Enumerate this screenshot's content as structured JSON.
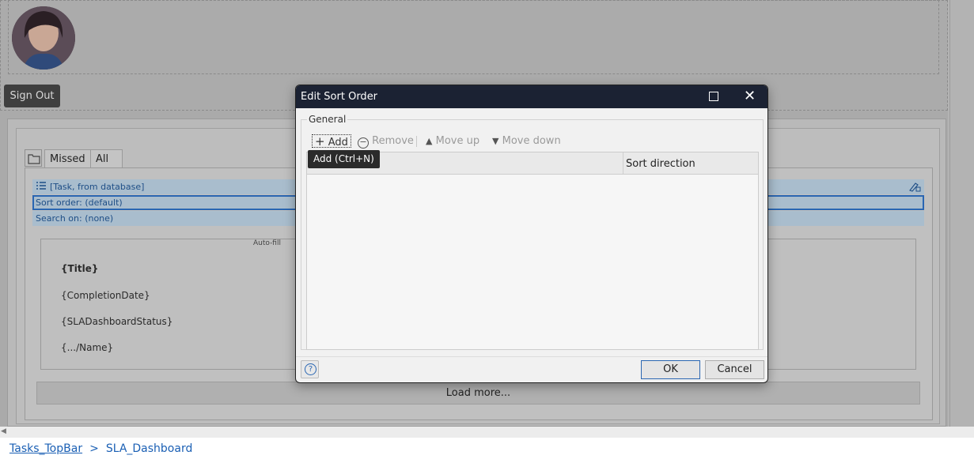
{
  "topbar": {
    "signout_label": "Sign Out"
  },
  "tabs": [
    {
      "label": "Missed"
    },
    {
      "label": "All"
    }
  ],
  "listview": {
    "datasource_label": "[Task, from database]",
    "sort_order_label": "Sort order: (default)",
    "search_on_label": "Search on: (none)",
    "autofill_label": "Auto-fill",
    "template_fields": [
      "{Title}",
      "{CompletionDate}",
      "{SLADashboardStatus}",
      "{.../Name}"
    ],
    "load_more_label": "Load more..."
  },
  "breadcrumb": {
    "items": [
      "Tasks_TopBar",
      "SLA_Dashboard"
    ],
    "separator": ">"
  },
  "dialog": {
    "title": "Edit Sort Order",
    "group_label": "General",
    "toolbar": {
      "add": "Add",
      "remove": "Remove",
      "move_up": "Move up",
      "move_down": "Move down"
    },
    "columns": {
      "sort_direction": "Sort direction"
    },
    "tooltip": "Add (Ctrl+N)",
    "ok_label": "OK",
    "cancel_label": "Cancel"
  },
  "colors": {
    "title_bar": "#1b2233",
    "accent": "#2a66b2",
    "link": "#1a5fb4"
  }
}
